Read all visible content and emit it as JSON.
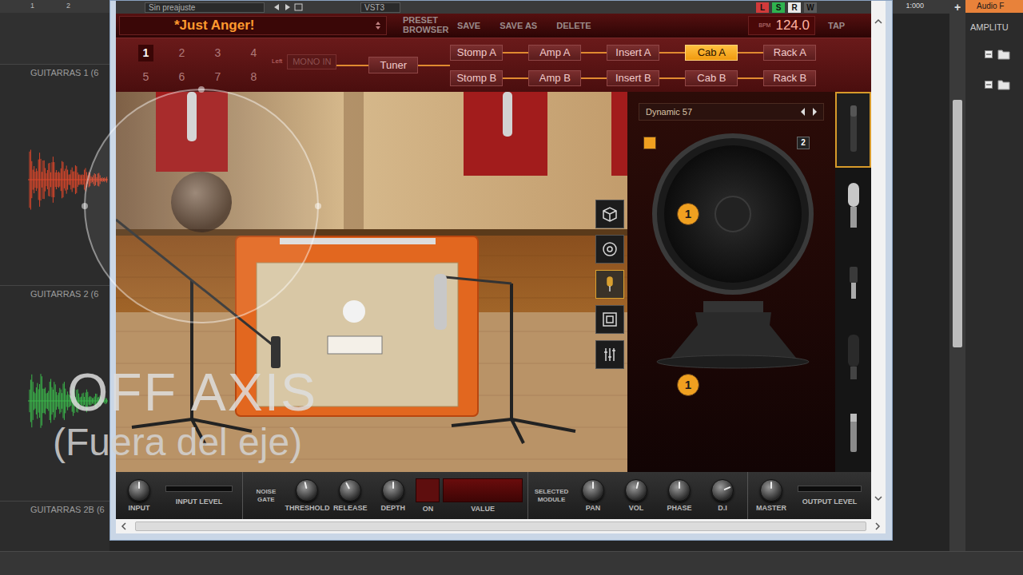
{
  "daw": {
    "ruler": [
      "1",
      "2"
    ],
    "time": "1:000",
    "add": "+",
    "tracks": [
      {
        "name": "GUITARRAS 1 (6",
        "has_wave": true,
        "color": "#d9472b"
      },
      {
        "name": "GUITARRAS 2 (6",
        "has_wave": true,
        "color": "#3bb54a"
      },
      {
        "name": "GUITARRAS 2B (6",
        "has_wave": false,
        "color": "#5a5a5a"
      }
    ],
    "panel": {
      "tab": "Audio F",
      "title": "AMPLITU",
      "tree": [
        {
          "expanded": true
        },
        {
          "expanded": true
        }
      ]
    }
  },
  "plugin": {
    "toolbar": {
      "preset": "Sin preajuste",
      "format": "VST3",
      "buttons": [
        {
          "label": "L",
          "on": true,
          "color": "#d23a3a"
        },
        {
          "label": "S",
          "on": true,
          "color": "#2fb34f"
        },
        {
          "label": "R",
          "on": true,
          "color": "#e8e8e8"
        },
        {
          "label": "W",
          "on": false,
          "color": "#bdbdbd"
        }
      ]
    },
    "header": {
      "preset_name": "*Just Anger!",
      "buttons": [
        "PRESET BROWSER",
        "SAVE",
        "SAVE AS",
        "DELETE"
      ],
      "bpm_label": "BPM",
      "bpm": "124.0",
      "tap": "TAP"
    },
    "slots": [
      {
        "label": "1",
        "selected": true
      },
      {
        "label": "2",
        "selected": false
      },
      {
        "label": "3",
        "selected": false
      },
      {
        "label": "4",
        "selected": false
      },
      {
        "label": "5",
        "selected": false
      },
      {
        "label": "6",
        "selected": false
      },
      {
        "label": "7",
        "selected": false
      },
      {
        "label": "8",
        "selected": false
      }
    ],
    "input": {
      "channel": "Left",
      "label": "MONO IN",
      "disabled": true
    },
    "tuner": {
      "label": "Tuner"
    },
    "chain": [
      {
        "modules": [
          {
            "label": "Stomp A",
            "selected": false
          },
          {
            "label": "Stomp B",
            "selected": false
          }
        ]
      },
      {
        "modules": [
          {
            "label": "Amp A",
            "selected": false
          },
          {
            "label": "Amp B",
            "selected": false
          }
        ]
      },
      {
        "modules": [
          {
            "label": "Insert A",
            "selected": false
          },
          {
            "label": "Insert B",
            "selected": false
          }
        ]
      },
      {
        "modules": [
          {
            "label": "Cab A",
            "selected": true
          },
          {
            "label": "Cab B",
            "selected": false
          }
        ]
      },
      {
        "modules": [
          {
            "label": "Rack A",
            "selected": false
          },
          {
            "label": "Rack B",
            "selected": false
          }
        ]
      }
    ],
    "tools": [
      {
        "kind": "cabinet",
        "selected": false
      },
      {
        "kind": "speaker",
        "selected": false
      },
      {
        "kind": "mic",
        "selected": true
      },
      {
        "kind": "room",
        "selected": false
      },
      {
        "kind": "mixer",
        "selected": false
      }
    ],
    "mic_panel": {
      "name": "Dynamic 57",
      "linked": true,
      "cab_badge": "2",
      "speaker_badge": "1",
      "cone_badge": "1"
    },
    "mics": [
      {
        "kind": "dynamic",
        "selected": true
      },
      {
        "kind": "condenser",
        "selected": false
      },
      {
        "kind": "ribbon",
        "selected": false
      },
      {
        "kind": "large",
        "selected": false
      },
      {
        "kind": "pencil",
        "selected": false
      }
    ],
    "controls": [
      {
        "items": [
          {
            "kind": "knob",
            "label": "INPUT",
            "level": 0.5
          },
          {
            "kind": "meter",
            "label": "INPUT LEVEL",
            "level": 0
          }
        ]
      },
      {
        "items": [
          {
            "kind": "caption",
            "label": "NOISE GATE"
          },
          {
            "kind": "knob",
            "label": "THRESHOLD",
            "level": 0.45
          },
          {
            "kind": "knob",
            "label": "RELEASE",
            "level": 0.4
          },
          {
            "kind": "knob",
            "label": "DEPTH",
            "level": 0.5
          },
          {
            "kind": "toggle",
            "label": "ON",
            "on": false
          },
          {
            "kind": "display",
            "label": "VALUE"
          }
        ]
      },
      {
        "items": [
          {
            "kind": "caption",
            "label": "SELECTED MODULE"
          },
          {
            "kind": "knob",
            "label": "PAN",
            "level": 0.5
          },
          {
            "kind": "knob",
            "label": "VOL",
            "level": 0.55
          },
          {
            "kind": "knob",
            "label": "PHASE",
            "level": 0.5
          },
          {
            "kind": "knob",
            "label": "D.I",
            "level": 0.75
          }
        ]
      },
      {
        "items": [
          {
            "kind": "knob",
            "label": "MASTER",
            "level": 0.5
          },
          {
            "kind": "meter",
            "label": "OUTPUT LEVEL",
            "level": 0
          }
        ]
      }
    ]
  },
  "overlay": {
    "title": "OFF AXIS",
    "subtitle": "(Fuera del eje)"
  }
}
